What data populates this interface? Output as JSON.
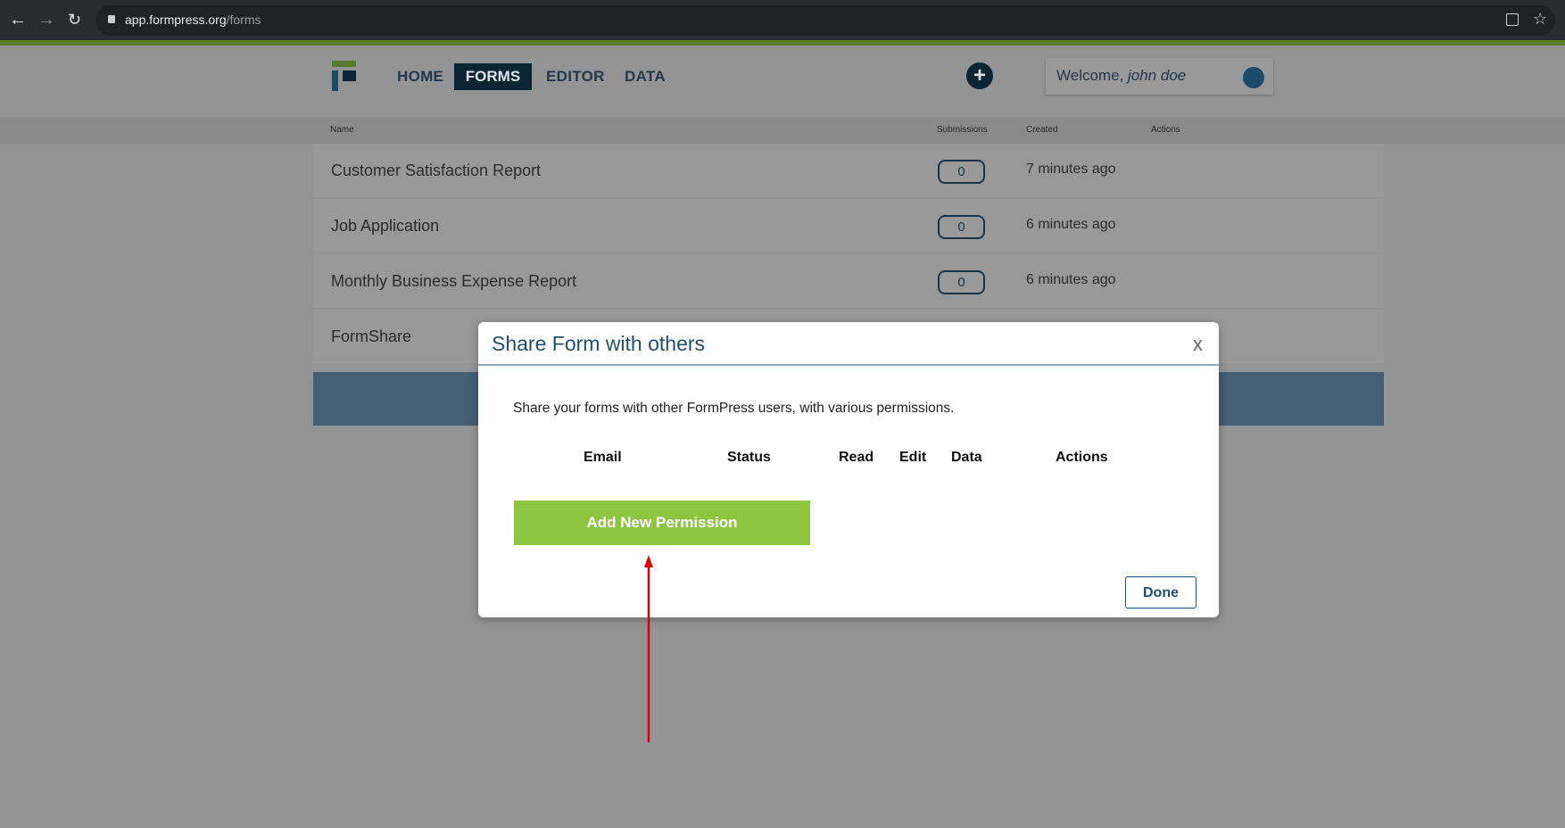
{
  "browser": {
    "url_host": "app.formpress.org",
    "url_path": "/forms",
    "icons": [
      "back-arrow-icon",
      "forward-arrow-icon",
      "reload-icon",
      "lock-icon",
      "translate-icon",
      "star-icon"
    ]
  },
  "nav": {
    "items": [
      "HOME",
      "FORMS",
      "EDITOR",
      "DATA"
    ],
    "active": "FORMS",
    "welcome": "Welcome, ",
    "user": "john doe"
  },
  "table": {
    "headers": {
      "name": "Name",
      "submissions": "Submissions",
      "created": "Created",
      "actions": "Actions"
    },
    "rows": [
      {
        "name": "Customer Satisfaction Report",
        "submissions": "0",
        "created": "7 minutes ago"
      },
      {
        "name": "Job Application",
        "submissions": "0",
        "created": "6 minutes ago"
      },
      {
        "name": "Monthly Business Expense Report",
        "submissions": "0",
        "created": "6 minutes ago"
      },
      {
        "name": "FormShare"
      }
    ]
  },
  "modal": {
    "title": "Share Form with others",
    "close": "x",
    "description": "Share your forms with other FormPress users, with various permissions.",
    "columns": [
      "Email",
      "Status",
      "Read",
      "Edit",
      "Data",
      "Actions"
    ],
    "add_button": "Add New Permission",
    "done_button": "Done"
  },
  "colors": {
    "accent_green": "#8dc641",
    "brand_navy": "#0b2535",
    "annotation_arrow": "#e00000"
  }
}
